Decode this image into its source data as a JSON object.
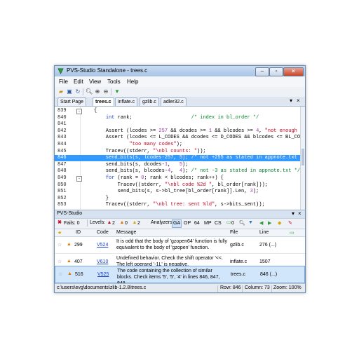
{
  "window": {
    "title": "PVS-Studio Standalone - trees.c"
  },
  "menu": [
    "File",
    "Edit",
    "View",
    "Tools",
    "Help"
  ],
  "tabs": [
    {
      "label": "Start Page",
      "active": false
    },
    {
      "label": "trees.c",
      "active": true
    },
    {
      "label": "inflate.c",
      "active": false
    },
    {
      "label": "gzlib.c",
      "active": false
    },
    {
      "label": "adler32.c",
      "active": false
    }
  ],
  "code": [
    {
      "ln": "839",
      "fold": "-",
      "text": "{"
    },
    {
      "ln": "840",
      "fold": "",
      "text": "    int rank;                    /* index in bl_order */"
    },
    {
      "ln": "841",
      "fold": "",
      "text": ""
    },
    {
      "ln": "842",
      "fold": "",
      "text": "    Assert (lcodes >= 257 && dcodes >= 1 && blcodes >= 4, \"not enough co"
    },
    {
      "ln": "843",
      "fold": "",
      "text": "    Assert (lcodes <= L_CODES && dcodes <= D_CODES && blcodes <= BL_CODE"
    },
    {
      "ln": "844",
      "fold": "",
      "text": "            \"too many codes\");"
    },
    {
      "ln": "845",
      "fold": "",
      "text": "    Tracev((stderr, \"\\nbl counts: \"));"
    },
    {
      "ln": "846",
      "fold": "",
      "text": "    send_bits(s, lcodes-257, 5); /* not +255 as stated in appnote.txt */"
    },
    {
      "ln": "847",
      "fold": "",
      "text": "    send_bits(s, dcodes-1,   5);"
    },
    {
      "ln": "848",
      "fold": "",
      "text": "    send_bits(s, blcodes-4,  4); /* not -3 as stated in appnote.txt */"
    },
    {
      "ln": "849",
      "fold": "-",
      "text": "    for (rank = 0; rank < blcodes; rank++) {"
    },
    {
      "ln": "850",
      "fold": "",
      "text": "        Tracev((stderr, \"\\nbl code %2d \", bl_order[rank]));"
    },
    {
      "ln": "851",
      "fold": "",
      "text": "        send_bits(s, s->bl_tree[bl_order[rank]].Len, 3);"
    },
    {
      "ln": "852",
      "fold": "",
      "text": "    }"
    },
    {
      "ln": "853",
      "fold": "",
      "text": "    Tracev((stderr, \"\\nbl tree: sent %ld\", s->bits_sent));"
    }
  ],
  "highlighted_line": "846",
  "pvs_panel": {
    "title": "PVS-Studio",
    "fails_label": "Fails: 0",
    "levels_label": "Levels:",
    "level_counts": [
      "2",
      "0",
      "2"
    ],
    "zero_count": "0",
    "analyzers_label": "Analyzers:",
    "analyzers": [
      "GA",
      "OP",
      "64",
      "MP",
      "CS"
    ],
    "filter_count": "0",
    "columns": [
      "ID",
      "Code",
      "Message",
      "File",
      "Line"
    ],
    "rows": [
      {
        "id": "299",
        "code": "V524",
        "message": "It is odd that the body of 'gzopen64' function is fully equivalent to the body of 'gzopen' function.",
        "file": "gzlib.c",
        "line": "276 (...)"
      },
      {
        "id": "407",
        "code": "V610",
        "message": "Undefined behavior. Check the shift operator '<<. The left operand '-1L' is negative.",
        "file": "inflate.c",
        "line": "1507"
      },
      {
        "id": "516",
        "code": "V525",
        "message": "The code containing the collection of similar blocks. Check items '5', '5', '4' in lines 846, 847, 848.",
        "file": "trees.c",
        "line": "846 (...)"
      }
    ]
  },
  "status": {
    "path": "c:\\users\\evg\\documents\\zlib-1.2.8\\trees.c",
    "row": "Row: 846",
    "column": "Column: 73",
    "zoom": "Zoom: 100%"
  },
  "colors": {
    "highlight": "#3399ff",
    "keyword": "#1a3fd2",
    "comment": "#00802a",
    "string": "#c8001e",
    "selected_row": "#d2e6fb"
  },
  "icons": [
    "open-icon",
    "save-icon",
    "refresh-icon",
    "zoom-icon",
    "filter-icon",
    "star-icon",
    "warning-icon"
  ]
}
